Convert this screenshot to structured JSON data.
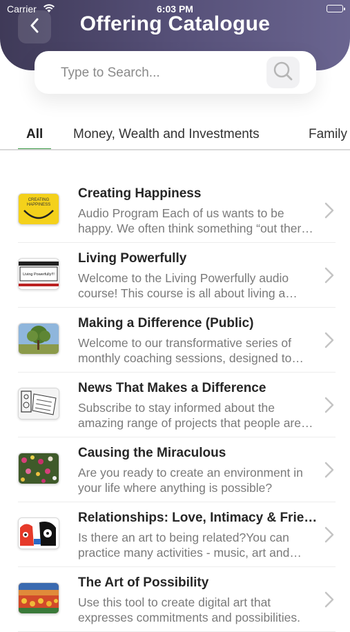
{
  "status_bar": {
    "carrier": "Carrier",
    "time": "6:03 PM"
  },
  "header": {
    "title": "Offering Catalogue",
    "back_icon": "chevron-left-icon"
  },
  "search": {
    "placeholder": "Type to Search...",
    "value": "",
    "icon": "search-icon"
  },
  "tabs": [
    {
      "label": "All",
      "active": true
    },
    {
      "label": "Money, Wealth and Investments",
      "active": false
    },
    {
      "label": "Family",
      "active": false
    }
  ],
  "items": [
    {
      "title": "Creating Happiness",
      "description": "Audio Program Each of us wants to be happy. We often think something “out there” will make us happy.",
      "thumb_text": "CREATING HAPPINESS"
    },
    {
      "title": "Living Powerfully",
      "description": "Welcome to the Living Powerfully audio course! This course is all about living a powerful life.",
      "thumb_text": "Living Powerfully!!!"
    },
    {
      "title": "Making a Difference (Public)",
      "description": "Welcome to our transformative series of monthly coaching sessions, designed to make a difference."
    },
    {
      "title": "News That Makes a Difference",
      "description": "Subscribe to stay informed about the amazing range of projects that people are creating."
    },
    {
      "title": "Causing the Miraculous",
      "description": "Are you ready to create an environment in your life where anything is possible?"
    },
    {
      "title": "Relationships: Love, Intimacy & Friendship",
      "description": "Is there an art to being related?You can practice many activities - music, art and more."
    },
    {
      "title": "The Art of Possibility",
      "description": "Use this tool to create digital art that expresses commitments and possibilities."
    }
  ]
}
